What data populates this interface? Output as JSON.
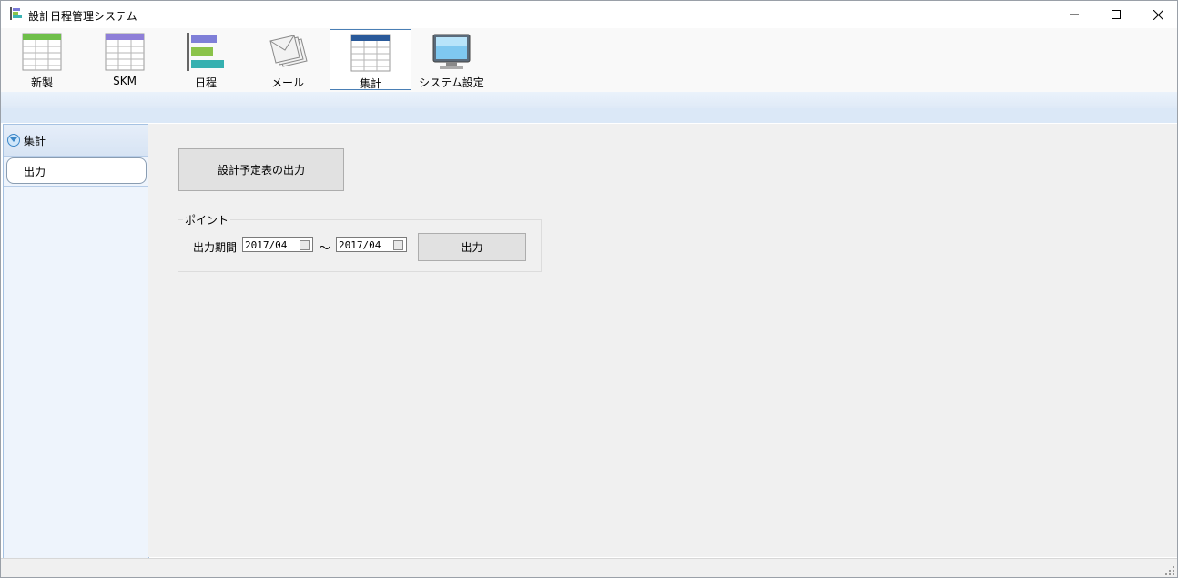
{
  "window": {
    "title": "設計日程管理システム"
  },
  "toolbar": {
    "items": [
      {
        "label": "新製",
        "icon": "table-green-icon",
        "active": false
      },
      {
        "label": "SKM",
        "icon": "table-purple-icon",
        "active": false
      },
      {
        "label": "日程",
        "icon": "gantt-icon",
        "active": false
      },
      {
        "label": "メール",
        "icon": "mail-icon",
        "active": false
      },
      {
        "label": "集計",
        "icon": "table-blue-icon",
        "active": true
      },
      {
        "label": "システム設定",
        "icon": "monitor-icon",
        "active": false
      }
    ]
  },
  "sidebar": {
    "header": "集計",
    "items": [
      {
        "label": "出力"
      }
    ]
  },
  "main": {
    "export_button": "設計予定表の出力",
    "group": {
      "title": "ポイント",
      "period_label": "出力期間",
      "from_date": "2017/04",
      "separator": "～",
      "to_date": "2017/04",
      "output_button": "出力"
    }
  },
  "colors": {
    "accent": "#4a7fb5",
    "sidebar_bg": "#eef4fc",
    "main_bg": "#f0f0f0"
  }
}
